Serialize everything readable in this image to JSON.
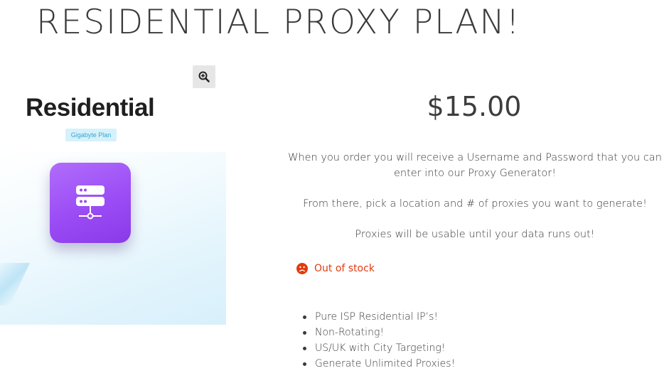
{
  "page": {
    "title": "RESIDENTIAL PROXY PLAN!"
  },
  "product_image": {
    "heading": "Residential",
    "badge": "Gigabyte Plan",
    "tile_icon": "server-network-icon",
    "zoom_icon": "zoom-in-icon",
    "colors": {
      "tile_gradient_start": "#b06dfb",
      "tile_gradient_end": "#8a3ae8",
      "badge_bg": "#d5f1fb",
      "badge_text": "#3aa6d1"
    }
  },
  "product": {
    "price": "$15.00",
    "description": [
      "When you order you will receive a Username and Password that you can enter into our Proxy Generator!",
      "From there, pick a location and # of proxies you want to generate!",
      "Proxies will be usable until your data runs out!"
    ],
    "stock": {
      "icon": "sad-face-icon",
      "text": "Out of stock",
      "color": "#e23b0e"
    },
    "features": [
      "Pure ISP Residential IP’s!",
      "Non-Rotating!",
      "US/UK with City Targeting!",
      "Generate Unlimited Proxies!"
    ]
  }
}
